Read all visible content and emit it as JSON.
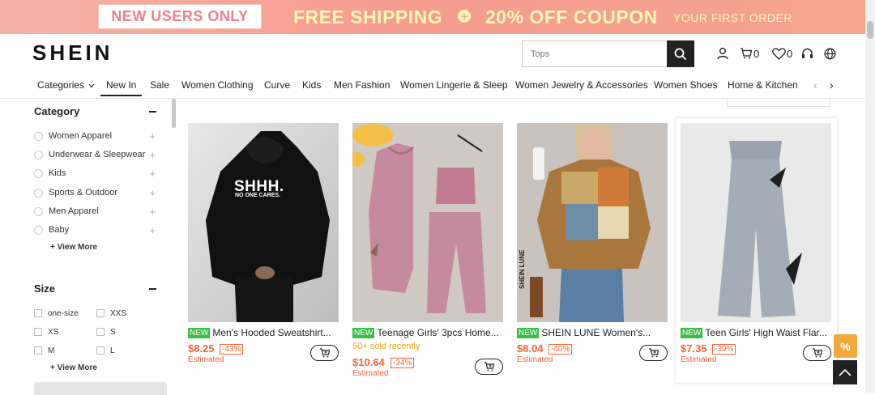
{
  "promo": {
    "new_users": "NEW USERS ONLY",
    "free_shipping": "FREE SHIPPING",
    "coupon": "20% OFF COUPON",
    "first_order": "YOUR FIRST ORDER"
  },
  "header": {
    "logo": "SHEIN",
    "search_placeholder": "Tops",
    "cart_count": "0",
    "wishlist_count": "0"
  },
  "nav": {
    "items": [
      "Categories",
      "New In",
      "Sale",
      "Women Clothing",
      "Curve",
      "Kids",
      "Men Fashion",
      "Women Lingerie & Sleep",
      "Women Jewelry & Accessories",
      "Women Shoes",
      "Home & Kitchen"
    ]
  },
  "sidebar": {
    "category_title": "Category",
    "categories": [
      {
        "label": "Women Apparel"
      },
      {
        "label": "Underwear & Sleepwear"
      },
      {
        "label": "Kids"
      },
      {
        "label": "Sports & Outdoor"
      },
      {
        "label": "Men Apparel"
      },
      {
        "label": "Baby"
      }
    ],
    "view_more": "View More",
    "size_title": "Size",
    "sizes": [
      "one-size",
      "XXS",
      "XS",
      "S",
      "M",
      "L"
    ],
    "size_view_more": "View More"
  },
  "products": [
    {
      "badge": "NEW",
      "title": "Men's Hooded Sweatshirt...",
      "price": "$8.25",
      "discount": "-43%",
      "estimated": "Estimated",
      "sold": "",
      "print": "SHHH.",
      "print_sub": "NO ONE CARES."
    },
    {
      "badge": "NEW",
      "title": "Teenage Girls' 3pcs Home...",
      "price": "$10.64",
      "discount": "-34%",
      "estimated": "Estimated",
      "sold": "50+ sold recently"
    },
    {
      "badge": "NEW",
      "title": "SHEIN LUNE Women's...",
      "price": "$8.04",
      "discount": "-40%",
      "estimated": "Estimated",
      "sold": "",
      "watermark": "SHEIN LUNE"
    },
    {
      "badge": "NEW",
      "title": "Teen Girls' High Waist Flar...",
      "price": "$7.35",
      "discount": "-39%",
      "estimated": "Estimated",
      "sold": ""
    }
  ],
  "widgets": {
    "percent_badge": "%"
  },
  "colors": {
    "accent_price": "#fa6338",
    "new_badge": "#3cbd45",
    "promo_text": "#fff6b3",
    "new_users_text": "#f07f92"
  }
}
